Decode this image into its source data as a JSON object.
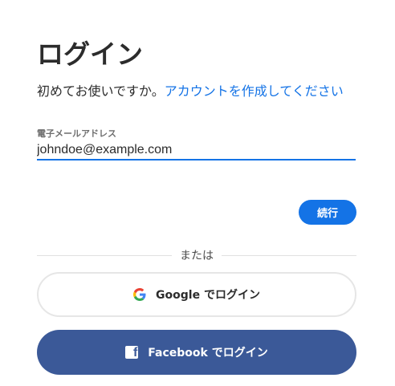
{
  "page": {
    "title": "ログイン",
    "subtitle_text": "初めてお使いですか。",
    "subtitle_link": "アカウントを作成してください"
  },
  "email": {
    "label": "電子メールアドレス",
    "value": "johndoe@example.com"
  },
  "continue_label": "続行",
  "divider_text": "または",
  "google": {
    "brand": "Google",
    "suffix": " でログイン",
    "icon": "google-icon"
  },
  "facebook": {
    "brand": "Facebook",
    "suffix": " でログイン",
    "icon": "facebook-icon"
  },
  "colors": {
    "accent": "#1473e6",
    "facebook": "#3b5998",
    "text": "#2c2c2c"
  }
}
